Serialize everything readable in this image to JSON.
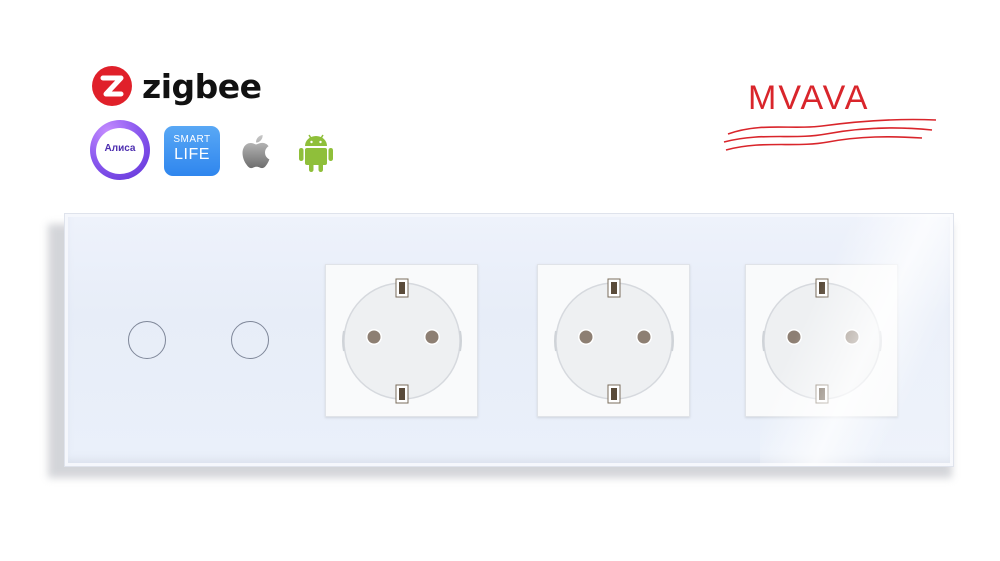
{
  "brand": {
    "zigbee_text": "zigbee",
    "mvava_text": "MVAVA",
    "accent_red": "#d9252b",
    "zigbee_red": "#e0202a"
  },
  "apps": [
    {
      "name": "alice-icon",
      "label": "Алиса"
    },
    {
      "name": "smart-life-icon",
      "label_top": "SMART",
      "label_bottom": "LIFE"
    },
    {
      "name": "apple-icon"
    },
    {
      "name": "android-icon"
    }
  ],
  "panel": {
    "color": "#eaf0fa",
    "touch_buttons": 2,
    "sockets": 3
  }
}
